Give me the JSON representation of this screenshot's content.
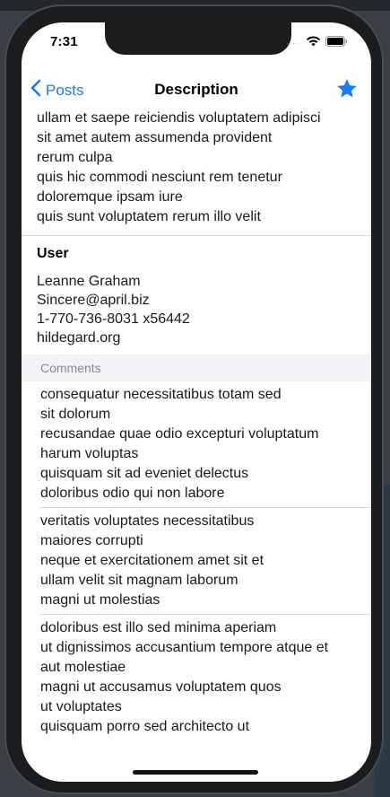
{
  "status_bar": {
    "time": "7:31",
    "signal": "....."
  },
  "nav": {
    "back_label": "Posts",
    "title": "Description"
  },
  "post_body": [
    "ullam et saepe reiciendis voluptatem adipisci",
    "sit amet autem assumenda provident",
    "rerum culpa",
    "quis hic commodi nesciunt rem tenetur",
    "doloremque ipsam iure",
    "quis sunt voluptatem rerum illo velit"
  ],
  "user": {
    "heading": "User",
    "name": "Leanne Graham",
    "email": "Sincere@april.biz",
    "phone": "1-770-736-8031 x56442",
    "website": "hildegard.org"
  },
  "comments": {
    "header": "Comments",
    "items": [
      {
        "lines": [
          "consequatur necessitatibus totam sed",
          "sit dolorum",
          "recusandae quae odio excepturi voluptatum",
          "harum voluptas",
          "quisquam sit ad eveniet delectus",
          "doloribus odio qui non labore"
        ]
      },
      {
        "lines": [
          "veritatis voluptates necessitatibus",
          "maiores corrupti",
          "neque et exercitationem amet sit et",
          "ullam velit sit magnam laborum",
          "magni ut molestias"
        ]
      },
      {
        "lines": [
          "doloribus est illo sed minima aperiam",
          "ut dignissimos accusantium tempore atque et",
          "aut molestiae",
          "magni ut accusamus voluptatem quos",
          "ut voluptates",
          "quisquam porro sed architecto ut"
        ]
      }
    ]
  },
  "colors": {
    "accent": "#1a7cf4",
    "section_bg": "#f2f2f7"
  }
}
